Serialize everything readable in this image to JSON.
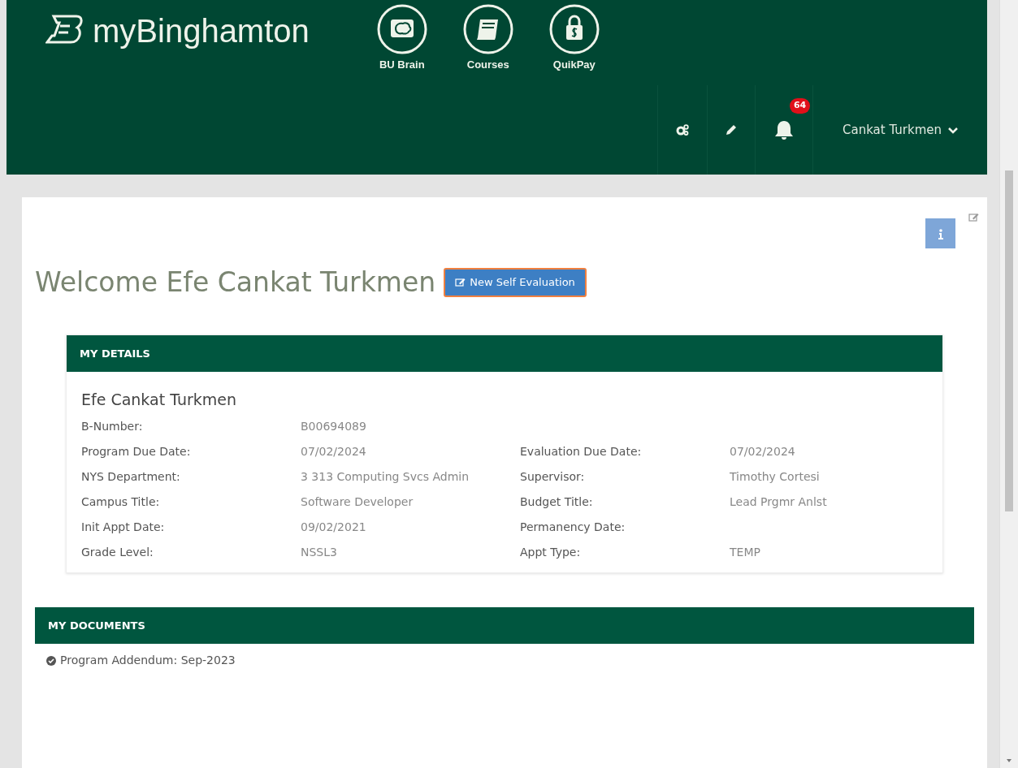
{
  "header": {
    "brand": "myBinghamton",
    "apps": [
      {
        "label": "BU Brain"
      },
      {
        "label": "Courses"
      },
      {
        "label": "QuikPay"
      }
    ],
    "notification_count": "64",
    "user": "Cankat Turkmen"
  },
  "page": {
    "title": "Welcome Efe Cankat Turkmen",
    "new_button": "New Self Evaluation"
  },
  "details": {
    "heading": "MY DETAILS",
    "name": "Efe Cankat Turkmen",
    "rows": [
      [
        {
          "label": "B-Number:",
          "value": "B00694089"
        }
      ],
      [
        {
          "label": "Program Due Date:",
          "value": "07/02/2024"
        },
        {
          "label": "Evaluation Due Date:",
          "value": "07/02/2024"
        }
      ],
      [
        {
          "label": "NYS Department:",
          "value": "3 313 Computing Svcs Admin"
        },
        {
          "label": "Supervisor:",
          "value": "Timothy Cortesi"
        }
      ],
      [
        {
          "label": "Campus Title:",
          "value": "Software Developer"
        },
        {
          "label": "Budget Title:",
          "value": "Lead Prgmr Anlst"
        }
      ],
      [
        {
          "label": "Init Appt Date:",
          "value": "09/02/2021"
        },
        {
          "label": "Permanency Date:"
        }
      ],
      [
        {
          "label": "Grade Level:",
          "value": "NSSL3"
        },
        {
          "label": "Appt Type:",
          "value": "TEMP"
        }
      ]
    ]
  },
  "documents": {
    "heading": "MY DOCUMENTS",
    "items": [
      {
        "text": "Program Addendum: Sep-2023",
        "confirmed": true
      }
    ]
  }
}
